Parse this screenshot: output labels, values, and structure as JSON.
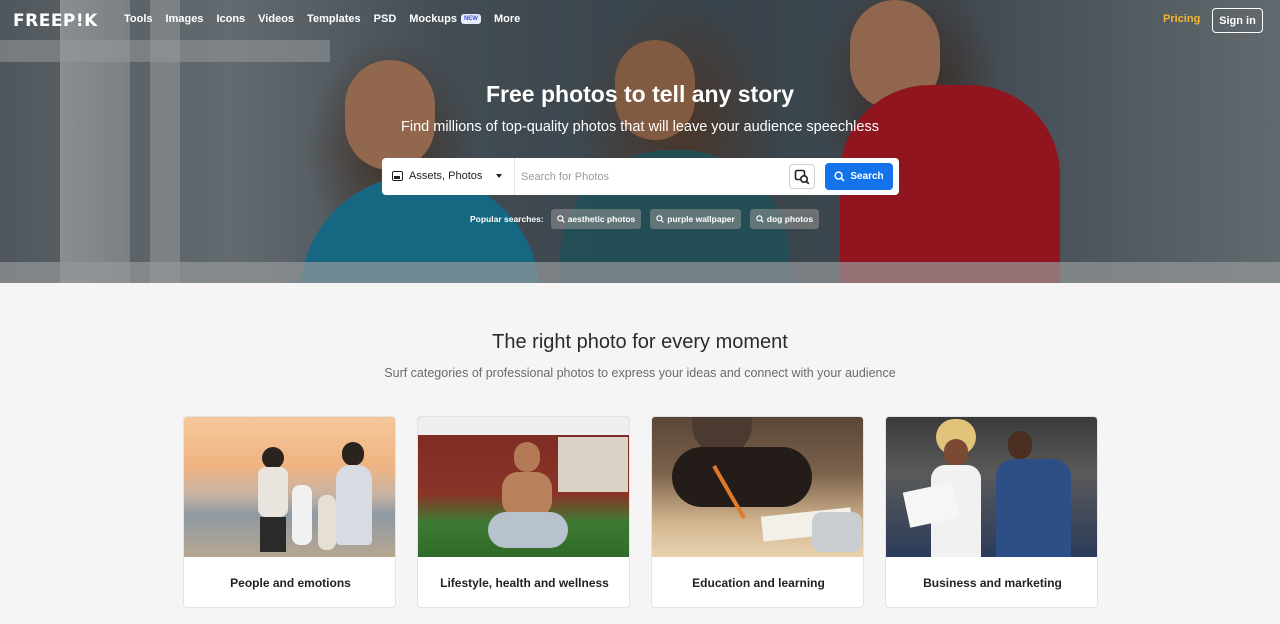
{
  "nav": {
    "logo": "FREEP!K",
    "items": [
      "Tools",
      "Images",
      "Icons",
      "Videos",
      "Templates",
      "PSD",
      "Mockups",
      "More"
    ],
    "mockups_badge": "NEW",
    "pricing": "Pricing",
    "signin": "Sign in"
  },
  "hero": {
    "title": "Free photos to tell any story",
    "subtitle": "Find millions of top-quality photos that will leave your audience speechless"
  },
  "search": {
    "asset_type": "Assets, Photos",
    "placeholder": "Search for Photos",
    "button": "Search"
  },
  "popular": {
    "label": "Popular searches:",
    "chips": [
      "aesthetic photos",
      "purple wallpaper",
      "dog photos"
    ]
  },
  "section": {
    "title": "The right photo for every moment",
    "subtitle": "Surf categories of professional photos to express your ideas and connect with your audience"
  },
  "categories": [
    {
      "label": "People and emotions"
    },
    {
      "label": "Lifestyle, health and wellness"
    },
    {
      "label": "Education and learning"
    },
    {
      "label": "Business and marketing"
    }
  ],
  "colors": {
    "accent": "#1273eb",
    "pricing": "#f5b52e"
  }
}
